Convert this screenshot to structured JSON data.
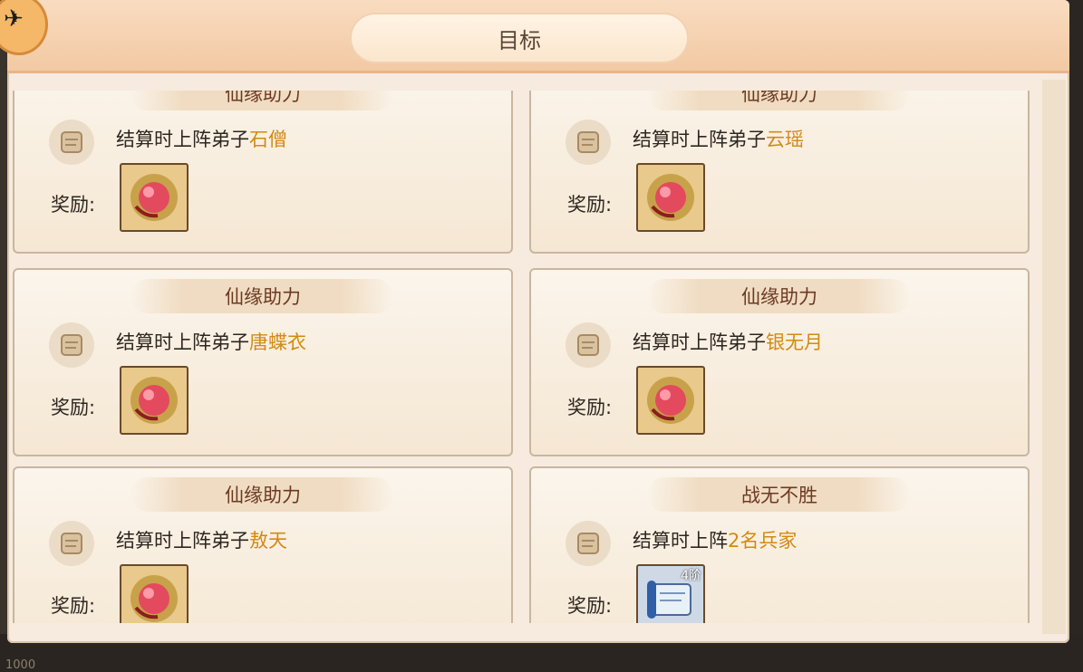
{
  "header": {
    "title": "目标"
  },
  "bottom_number": "1000",
  "labels": {
    "reward": "奖励:"
  },
  "cards": [
    {
      "title": "仙缘助力",
      "condition_prefix": "结算时上阵弟子",
      "condition_highlight": "石僧",
      "reward_icon": "red-orb-gem-icon"
    },
    {
      "title": "仙缘助力",
      "condition_prefix": "结算时上阵弟子",
      "condition_highlight": "云瑶",
      "reward_icon": "red-orb-gem-icon"
    },
    {
      "title": "仙缘助力",
      "condition_prefix": "结算时上阵弟子",
      "condition_highlight": "唐蝶衣",
      "reward_icon": "red-orb-gem-icon"
    },
    {
      "title": "仙缘助力",
      "condition_prefix": "结算时上阵弟子",
      "condition_highlight": "银无月",
      "reward_icon": "red-orb-gem-icon"
    },
    {
      "title": "仙缘助力",
      "condition_prefix": "结算时上阵弟子",
      "condition_highlight": "敖天",
      "reward_icon": "red-orb-gem-icon"
    },
    {
      "title": "战无不胜",
      "condition_prefix": "结算时上阵",
      "condition_highlight": "2名兵家",
      "reward_icon": "scroll-tier-icon",
      "reward_badge": "4阶"
    }
  ]
}
